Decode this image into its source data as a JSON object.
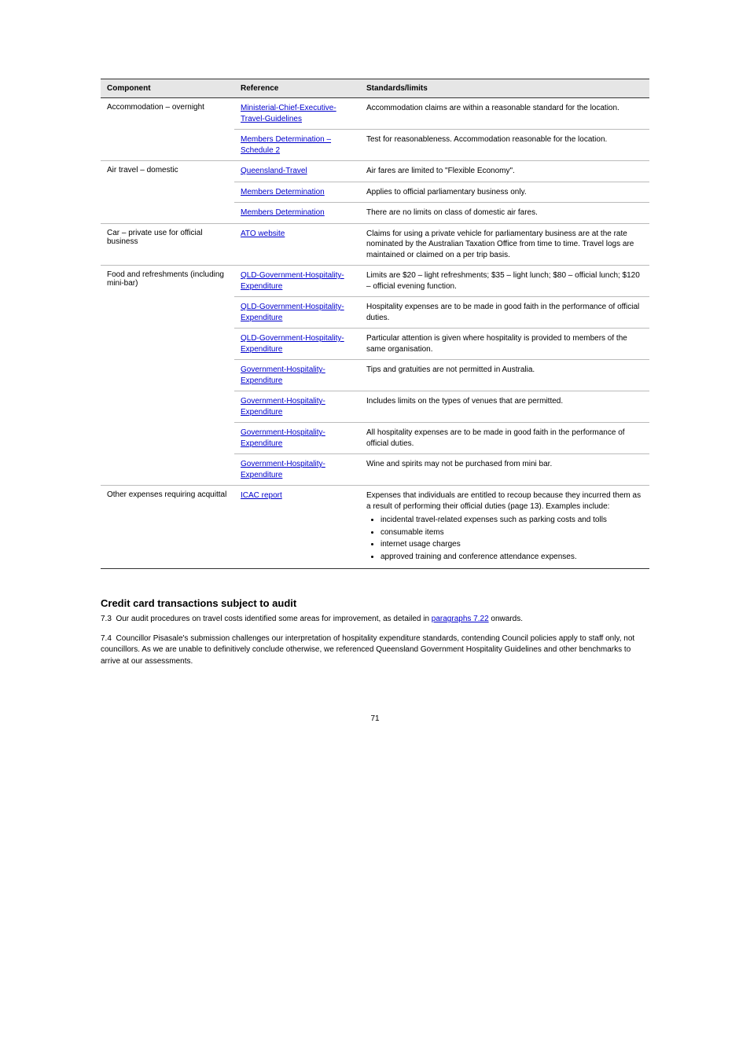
{
  "table": {
    "headers": [
      "Component",
      "Reference",
      "Standards/limits"
    ],
    "groups": [
      {
        "category": "Accommodation – overnight",
        "rows": [
          {
            "link": "Ministerial-Chief-Executive-Travel-Guidelines",
            "desc": "Accommodation claims are within a reasonable standard for the location."
          },
          {
            "link": "Members Determination – Schedule 2",
            "desc": "Test for reasonableness. Accommodation reasonable for the location."
          }
        ]
      },
      {
        "category": "Air travel – domestic",
        "rows": [
          {
            "link": "Queensland-Travel",
            "desc": "Air fares are limited to \"Flexible Economy\"."
          },
          {
            "link": "Members Determination",
            "desc": "Applies to official parliamentary business only."
          },
          {
            "link": "Members Determination",
            "desc": "There are no limits on class of domestic air fares."
          }
        ]
      },
      {
        "category": "Car – private use for official business",
        "rows": [
          {
            "link": "ATO website",
            "desc": "Claims for using a private vehicle for parliamentary business are at the rate nominated by the Australian Taxation Office from time to time. Travel logs are maintained or claimed on a per trip basis."
          }
        ]
      },
      {
        "category": "Food and refreshments (including mini-bar)",
        "rows": [
          {
            "link": "QLD-Government-Hospitality-Expenditure",
            "desc": "Limits are $20 – light refreshments; $35 – light lunch; $80 – official lunch; $120 – official evening function."
          },
          {
            "link": "QLD-Government-Hospitality-Expenditure",
            "desc": "Hospitality expenses are to be made in good faith in the performance of official duties."
          },
          {
            "link": "QLD-Government-Hospitality-Expenditure",
            "desc": "Particular attention is given where hospitality is provided to members of the same organisation."
          },
          {
            "link": "Government-Hospitality-Expenditure",
            "desc": "Tips and gratuities are not permitted in Australia."
          },
          {
            "link": "Government-Hospitality-Expenditure",
            "desc": "Includes limits on the types of venues that are permitted."
          },
          {
            "link": "Government-Hospitality-Expenditure",
            "desc": "All hospitality expenses are to be made in good faith in the performance of official duties."
          },
          {
            "link": "Government-Hospitality-Expenditure",
            "desc": "Wine and spirits may not be purchased from mini bar."
          }
        ]
      },
      {
        "category": "Other expenses requiring acquittal",
        "rows": [
          {
            "link": "ICAC report",
            "desc_intro": "Expenses that individuals are entitled to recoup because they incurred them as a result of performing their official duties (page 13). Examples include:",
            "bullets": [
              "incidental travel-related expenses such as parking costs and tolls",
              "consumable items",
              "internet usage charges",
              "approved training and conference attendance expenses."
            ]
          }
        ]
      }
    ]
  },
  "footer": {
    "heading": "Credit card transactions subject to audit",
    "p1_pre": "Our audit procedures on travel costs identified some areas for improvement, as detailed in ",
    "p1_link": "paragraphs 7.22",
    "p1_post": " onwards.",
    "p2": "Councillor Pisasale's submission challenges our interpretation of hospitality expenditure standards, contending Council policies apply to staff only, not councillors. As we are unable to definitively conclude otherwise, we referenced Queensland Government Hospitality Guidelines and other benchmarks to arrive at our assessments."
  },
  "section_marker": "7.3",
  "section_marker2": "7.4",
  "page_number": "71"
}
